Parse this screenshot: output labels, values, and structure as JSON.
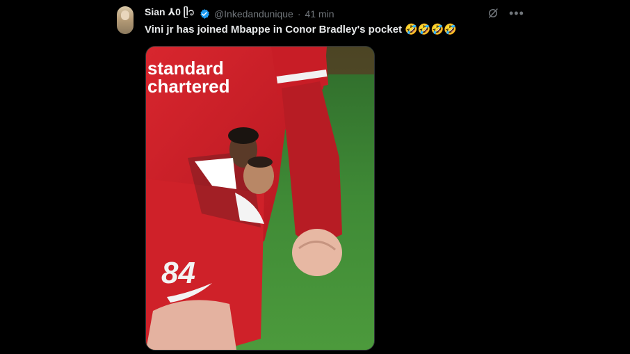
{
  "tweet": {
    "display_name": "Sian ⅄0 ᥫ᭡",
    "handle": "@Inkedandunique",
    "separator": "·",
    "time": "41 min",
    "text": "Vini jr has joined Mbappe in Conor Bradley's pocket 🤣🤣🤣🤣",
    "icons": {
      "avatar": "avatar",
      "verified": "verified-badge-icon",
      "grok": "grok-icon",
      "more": "more-icon"
    },
    "colors": {
      "verified": "#1d9bf0",
      "muted": "#71767b",
      "text": "#e7e9ea"
    },
    "media": {
      "shirt_sponsor_line1": "standard",
      "shirt_sponsor_line2": "chartered",
      "shorts_number": "84"
    }
  }
}
